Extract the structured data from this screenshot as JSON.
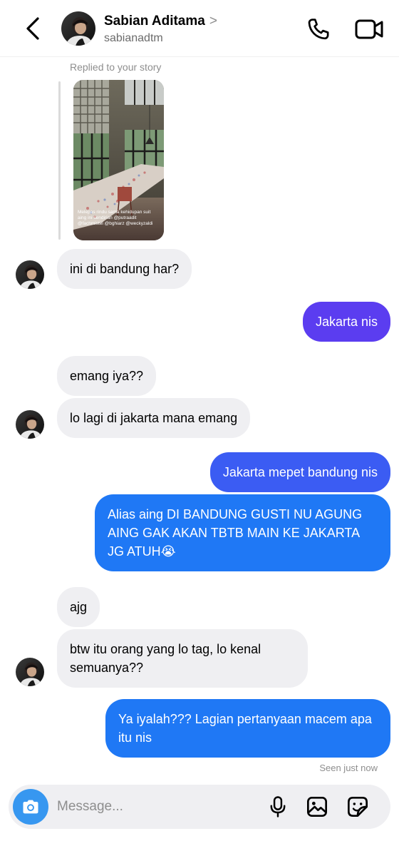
{
  "header": {
    "name": "Sabian Aditama",
    "username": "sabianadtm",
    "chevron": ">"
  },
  "story_reply": {
    "label": "Replied to your story",
    "caption": "Melepas rindu sama kehidupan suit aing ini sendirian @putraadit @fachmistei @bghiarz @weckyzaldi"
  },
  "messages": [
    {
      "dir": "in",
      "text": "ini di bandung har?"
    },
    {
      "dir": "out",
      "text": "Jakarta nis"
    },
    {
      "dir": "in",
      "text": "emang iya??"
    },
    {
      "dir": "in",
      "text": "lo lagi di jakarta mana emang"
    },
    {
      "dir": "out",
      "text": "Jakarta mepet bandung nis"
    },
    {
      "dir": "out",
      "text": "Alias aing DI BANDUNG GUSTI NU AGUNG AING GAK AKAN TBTB MAIN KE JAKARTA JG ATUH😭"
    },
    {
      "dir": "in",
      "text": "ajg"
    },
    {
      "dir": "in",
      "text": "btw itu orang yang lo tag, lo kenal semuanya??"
    },
    {
      "dir": "out",
      "text": "Ya iyalah??? Lagian pertanyaan macem apa itu nis"
    }
  ],
  "status": {
    "seen": "Seen just now"
  },
  "composer": {
    "placeholder": "Message..."
  },
  "icons": {
    "back": "chevron-left-icon",
    "call": "phone-icon",
    "video": "video-camera-icon",
    "camera": "camera-icon",
    "mic": "microphone-icon",
    "gallery": "image-icon",
    "sticker": "sticker-icon"
  },
  "colors": {
    "incoming_bubble": "#efeff2",
    "outgoing_bubble_top": "#5b3df0",
    "outgoing_bubble_bottom": "#1f78f5",
    "camera_button": "#3797f0",
    "secondary_text": "#8e8e8e"
  }
}
